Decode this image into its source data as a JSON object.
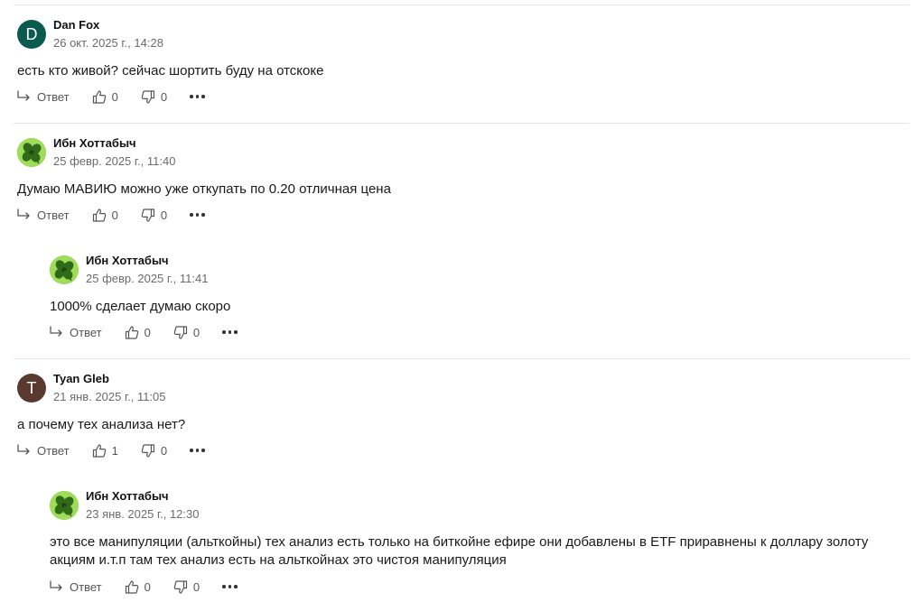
{
  "actions": {
    "reply_label": "Ответ"
  },
  "comments": [
    {
      "author": "Dan Fox",
      "avatar_letter": "D",
      "avatar_color": "#0b5a4e",
      "date": "26 окт. 2025 г., 14:28",
      "text": "есть кто живой? сейчас шортить буду на отскоке",
      "likes": "0",
      "dislikes": "0"
    },
    {
      "author": "Ибн Хоттабыч",
      "avatar_icon": "clover-icon",
      "date": "25 февр. 2025 г., 11:40",
      "text": "Думаю МАВИЮ можно уже откупать по 0.20 отличная цена",
      "likes": "0",
      "dislikes": "0"
    },
    {
      "author": "Ибн Хоттабыч",
      "avatar_icon": "clover-icon",
      "date": "25 февр. 2025 г., 11:41",
      "text": "1000% сделает думаю скоро",
      "likes": "0",
      "dislikes": "0",
      "reply": true
    },
    {
      "author": "Tyan Gleb",
      "avatar_letter": "T",
      "avatar_color": "#5a3a2e",
      "date": "21 янв. 2025 г., 11:05",
      "text": "а почему тех анализа нет?",
      "likes": "1",
      "dislikes": "0"
    },
    {
      "author": "Ибн Хоттабыч",
      "avatar_icon": "clover-icon",
      "date": "23 янв. 2025 г., 12:30",
      "text": "это все манипуляции (альткойны) тех анализ есть только на биткойне ефире они добавлены в ETF приравнены к доллару золоту акциям и.т.п там тех анализ есть на альткойнах это чистоя манипуляция",
      "likes": "0",
      "dislikes": "0",
      "reply": true
    }
  ]
}
